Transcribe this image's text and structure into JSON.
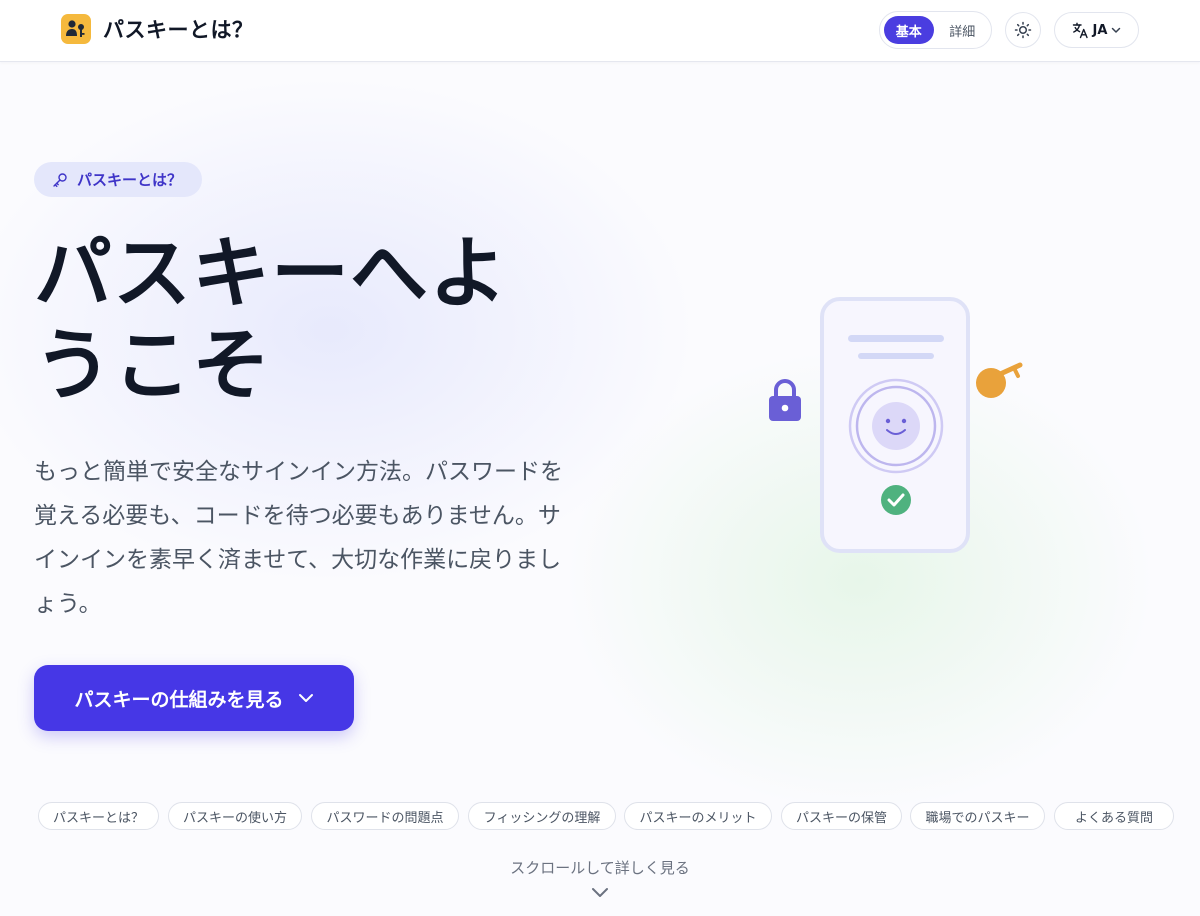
{
  "header": {
    "title": "パスキーとは？",
    "mode_basic": "基本",
    "mode_detail": "詳細",
    "lang_label": "JA"
  },
  "hero": {
    "badge": "パスキーとは？",
    "title": "パスキーへようこそ",
    "description": "もっと簡単で安全なサインイン方法。パスワードを覚える必要も、コードを待つ必要もありません。サインインを素早く済ませて、大切な作業に戻りましょう。",
    "cta_label": "パスキーの仕組みを見る"
  },
  "topics": [
    "パスキーとは？",
    "パスキーの使い方",
    "パスワードの問題点",
    "フィッシングの理解",
    "パスキーのメリット",
    "パスキーの保管",
    "職場でのパスキー",
    "よくある質問"
  ],
  "scroll_hint": "スクロールして詳しく見る",
  "icons": {
    "logo": "user-key-icon",
    "theme": "sun-icon",
    "language": "translate-icon",
    "badge": "key-icon",
    "lock": "lock-icon",
    "key": "key-icon",
    "face": "face-id-icon",
    "check": "check-circle-icon"
  },
  "colors": {
    "accent": "#4637e6",
    "logo_bg": "#f5b93d",
    "success": "#4caf7d",
    "lock": "#6a5fd6",
    "key": "#e9a23b"
  }
}
